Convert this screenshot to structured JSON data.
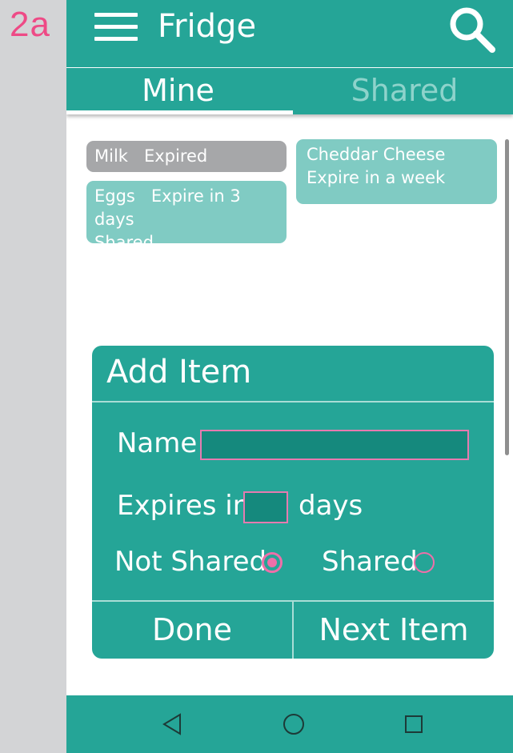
{
  "annotation": {
    "label": "2a"
  },
  "appbar": {
    "title": "Fridge"
  },
  "tabs": [
    {
      "label": "Mine",
      "active": true
    },
    {
      "label": "Shared",
      "active": false
    }
  ],
  "items": {
    "milk": {
      "name": "Milk",
      "status": "Expired"
    },
    "eggs": {
      "name": "Eggs",
      "status": "Expire in 3 days",
      "note": "Shared"
    },
    "cheese": {
      "name": "Cheddar Cheese",
      "status": "Expire in a week"
    }
  },
  "dialog": {
    "title": "Add Item",
    "name_label": "Name",
    "name_value": "",
    "expires_label": "Expires in",
    "days_value": "",
    "days_label": "days",
    "not_shared_label": "Not Shared",
    "shared_label": "Shared",
    "selected_option": "Not Shared",
    "done_label": "Done",
    "next_label": "Next Item"
  },
  "nav": {
    "icons": [
      "back-icon",
      "home-icon",
      "recents-icon"
    ]
  },
  "colors": {
    "primary": "#25a597",
    "accent": "#ee6fa9",
    "expired": "#a6a7a9",
    "card": "#80cbc3",
    "annotation": "#ee4a86"
  }
}
